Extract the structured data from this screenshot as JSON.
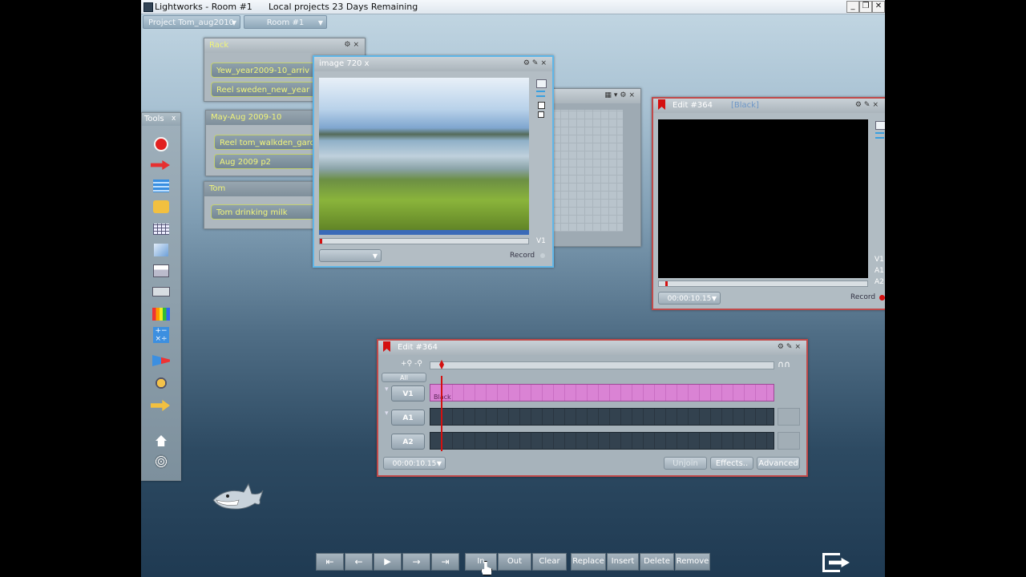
{
  "window": {
    "app_title": "Lightworks - Room #1",
    "license": "Local projects 23 Days Remaining",
    "min": "_",
    "max": "❐",
    "close": "✕"
  },
  "project_bar": {
    "project": "Project Tom_aug2010",
    "room": "Room #1"
  },
  "rack": {
    "title": "Rack",
    "items": [
      "Yew_year2009-10_arriv",
      "Reel sweden_new_year"
    ],
    "groups": [
      {
        "title": "May-Aug 2009-10",
        "items": [
          "Reel tom_walkden_gard",
          "Aug 2009 p2"
        ]
      },
      {
        "title": "Tom",
        "items": [
          "Tom drinking milk"
        ]
      }
    ]
  },
  "tools": {
    "title": "Tools",
    "close": "x"
  },
  "source_viewer": {
    "title": "image 720 x",
    "track": "V1",
    "record": "Record"
  },
  "record_viewer": {
    "title": "Edit #364",
    "subtitle": "[Black]",
    "timecode": "00:00:10.15",
    "record": "Record",
    "tracks": [
      "V1",
      "A1",
      "A2"
    ]
  },
  "timeline": {
    "title": "Edit #364",
    "all": "All",
    "tracks": [
      {
        "label": "V1",
        "clip": "Black"
      },
      {
        "label": "A1"
      },
      {
        "label": "A2"
      }
    ],
    "timecode": "00:00:10.15",
    "buttons": {
      "unjoin": "Unjoin",
      "effects": "Effects..",
      "advanced": "Advanced"
    }
  },
  "transport": {
    "buttons": [
      "In",
      "Out",
      "Clear",
      "Replace",
      "Insert",
      "Delete",
      "Remove"
    ]
  },
  "colors": {
    "accent_yellow": "#f1f57a",
    "clip_pink": "#d67ad0",
    "playhead": "#d41010"
  }
}
